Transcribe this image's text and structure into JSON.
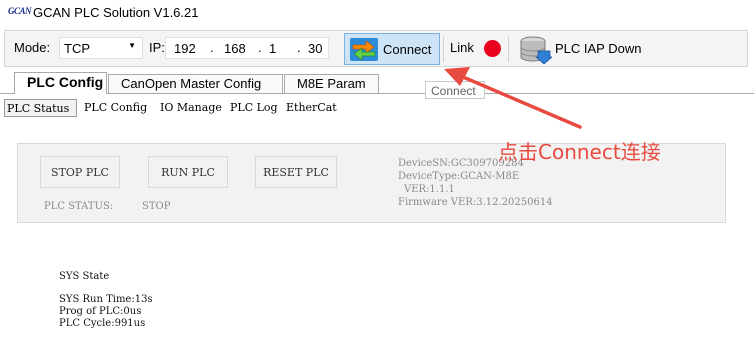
{
  "window": {
    "logo_text": "GCAN",
    "title": "GCAN PLC Solution V1.6.21"
  },
  "toolbar": {
    "mode_label": "Mode:",
    "mode_value": "TCP",
    "ip_label": "IP:",
    "ip_octets": [
      "192",
      "168",
      "1",
      "30"
    ],
    "ip_separator": ".",
    "connect_label": "Connect",
    "connect_icon": "connect-arrows-icon",
    "link_label": "Link",
    "link_status_color": "#e8001c",
    "iap_label": "PLC IAP Down",
    "iap_icon": "database-download-icon"
  },
  "tabs": [
    "PLC Config",
    "CanOpen Master Config",
    "M8E Param"
  ],
  "tooltip": "Connect",
  "subtabs": [
    "PLC Status",
    "PLC Config",
    "IO Manage",
    "PLC Log",
    "EtherCat"
  ],
  "controls": {
    "stop_label": "STOP PLC",
    "run_label": "RUN PLC",
    "reset_label": "RESET PLC",
    "status_label": "PLC STATUS:",
    "status_value": "STOP"
  },
  "device_info": {
    "sn": "DeviceSN:GC309709284",
    "type": "DeviceType:GCAN-M8E",
    "ver": "VER:1.1.1",
    "firmware": "Firmware VER:3.12.20250614"
  },
  "sys": {
    "title": "SYS State",
    "run_time": "SYS Run Time:13s",
    "prog": "Prog of PLC:0us",
    "cycle": "PLC Cycle:991us"
  },
  "annotation": {
    "text": "点击Connect连接",
    "color": "#e84a3f"
  }
}
